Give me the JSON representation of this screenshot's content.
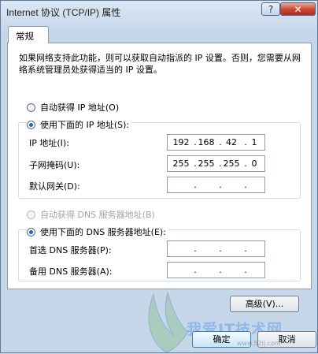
{
  "window": {
    "title": "Internet 协议 (TCP/IP) 属性",
    "help_label": "?",
    "close_label": "✕"
  },
  "tabs": [
    {
      "label": "常规"
    }
  ],
  "general": {
    "description": "如果网络支持此功能，则可以获取自动指派的 IP 设置。否则，您需要从网络系统管理员处获得适当的 IP 设置。",
    "ip_mode": {
      "auto_label": "自动获得 IP 地址(O)",
      "manual_label": "使用下面的 IP 地址(S):",
      "selected": "manual"
    },
    "ip_fields": {
      "ip_address": {
        "label": "IP 地址(I):",
        "value": [
          "192",
          "168",
          "42",
          "1"
        ]
      },
      "subnet_mask": {
        "label": "子网掩码(U):",
        "value": [
          "255",
          "255",
          "255",
          "0"
        ]
      },
      "default_gateway": {
        "label": "默认网关(D):",
        "value": [
          "",
          "",
          "",
          ""
        ]
      }
    },
    "dns_mode": {
      "auto_label": "自动获得 DNS 服务器地址(B)",
      "auto_enabled": false,
      "manual_label": "使用下面的 DNS 服务器地址(E):",
      "selected": "manual"
    },
    "dns_fields": {
      "preferred": {
        "label": "首选 DNS 服务器(P):",
        "value": [
          "",
          "",
          "",
          ""
        ]
      },
      "alternate": {
        "label": "备用 DNS 服务器(A):",
        "value": [
          "",
          "",
          "",
          ""
        ]
      }
    },
    "dot_separator": ".",
    "advanced_label": "高级(V)..."
  },
  "footer": {
    "ok_label": "确定",
    "cancel_label": "取消"
  },
  "watermark": {
    "text": "我爱IT技术网",
    "url": "www.52ij.com"
  },
  "colors": {
    "accent": "#2b63b8",
    "close": "#c9442e",
    "disabled_text": "#a3a3a3"
  }
}
